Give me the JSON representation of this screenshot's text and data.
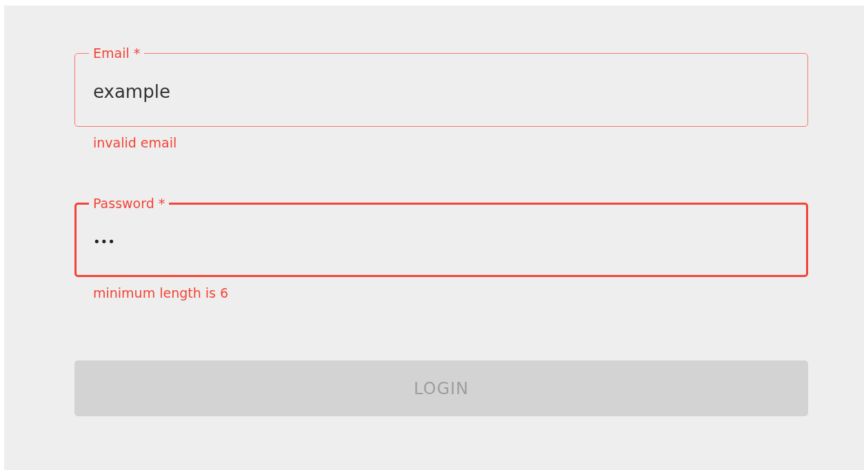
{
  "fields": [
    {
      "kind": "text",
      "label": "Email *",
      "value": "example",
      "error": true,
      "focused": false,
      "helper": "invalid email"
    },
    {
      "kind": "password",
      "label": "Password *",
      "value": "•••",
      "error": true,
      "focused": true,
      "helper": "minimum length is 6"
    }
  ],
  "button": {
    "label": "LOGIN",
    "disabled": true
  }
}
